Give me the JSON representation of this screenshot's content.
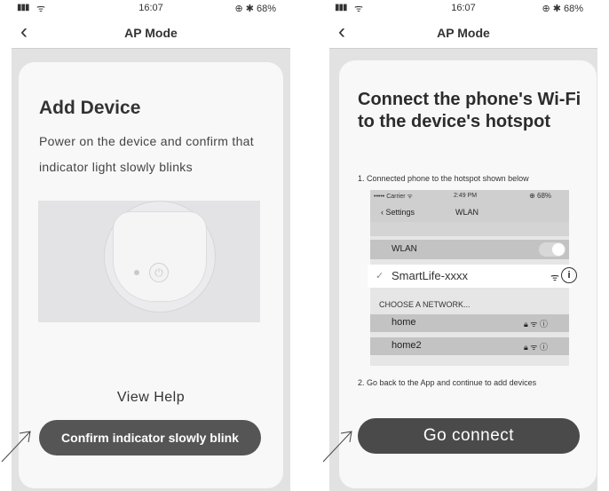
{
  "left_screen": {
    "status": {
      "signal": "▮▮▮",
      "time": "16:07",
      "battery": "⊕ ✱ 68%"
    },
    "nav": {
      "title": "AP Mode",
      "back": "‹"
    },
    "title": "Add Device",
    "description": "Power on the device and confirm that indicator light slowly blinks",
    "device_icon": "plug-device-icon",
    "view_help": "View Help",
    "confirm_button": "Confirm indicator slowly blink"
  },
  "right_screen": {
    "status": {
      "signal": "▮▮▮",
      "time": "16:07",
      "battery": "⊕ ✱ 68%"
    },
    "nav": {
      "title": "AP Mode",
      "back": "‹"
    },
    "title": "Connect the phone's Wi-Fi to the device's hotspot",
    "step1": "1. Connected phone to the hotspot shown below",
    "inner_phone": {
      "carrier": "••••• Carrier ᯤ",
      "time": "2:49 PM",
      "battery": "⊕  68%",
      "back_label": "‹ Settings",
      "nav_title": "WLAN",
      "wlan_label": "WLAN",
      "selected_network": "SmartLife-xxxx",
      "choose_label": "CHOOSE A NETWORK...",
      "networks": [
        {
          "name": "home"
        },
        {
          "name": "home2"
        }
      ]
    },
    "step2": "2. Go back to the App and continue to add devices",
    "go_button": "Go connect"
  },
  "colors": {
    "button": "#555555",
    "background": "#e2e2e2",
    "card": "#f8f8f8"
  }
}
